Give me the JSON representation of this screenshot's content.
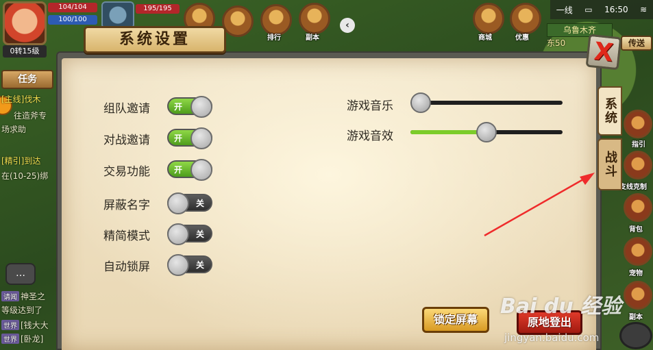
{
  "hud": {
    "level_text": "0转15级",
    "hp": "104/104",
    "mp": "100/100",
    "pet_hp": "195/195",
    "task_button": "任务",
    "top_icons": [
      "排行",
      "副本"
    ],
    "right_top_icons": [
      "商城",
      "优惠"
    ],
    "status_bar": {
      "line": "一线",
      "time": "16:50"
    },
    "map_name": "乌鲁木齐",
    "map_sub": "东50",
    "teleport": "传送",
    "right_side_icons": [
      "指引",
      "支线克制",
      "背包",
      "宠物",
      "副本"
    ]
  },
  "chat": {
    "lines": [
      {
        "text": "[主线]伐木",
        "color": "#f2e050"
      },
      {
        "text": "往造斧专",
        "color": "#e8e8c8"
      },
      {
        "text": "场求助",
        "color": "#e8e8c8"
      },
      {
        "text": "[精引]到达",
        "color": "#f2e050"
      },
      {
        "text": "在(10-25)绑",
        "color": "#e8e8c8"
      }
    ],
    "messages": [
      {
        "tag": "请闻",
        "text": "神圣之"
      },
      {
        "tag": "",
        "text": "等级达到了"
      },
      {
        "tag": "世界",
        "text": "[钱大大"
      },
      {
        "tag": "世界",
        "text": "[卧龙]"
      }
    ]
  },
  "dialog": {
    "title": "系统设置",
    "close_label": "X",
    "tabs": [
      {
        "label": "系统",
        "active": true
      },
      {
        "label": "战斗",
        "active": false
      }
    ],
    "settings": [
      {
        "label": "组队邀请",
        "on": true
      },
      {
        "label": "对战邀请",
        "on": true
      },
      {
        "label": "交易功能",
        "on": true
      },
      {
        "label": "屏蔽名字",
        "on": false
      },
      {
        "label": "精简模式",
        "on": false
      },
      {
        "label": "自动锁屏",
        "on": false
      }
    ],
    "toggle_on_text": "开",
    "toggle_off_text": "关",
    "audio": [
      {
        "label": "游戏音乐",
        "level": 0.0
      },
      {
        "label": "游戏音效",
        "level": 0.5
      }
    ],
    "lock_screen_button": "锁定屏幕",
    "logout_button": "原地登出"
  },
  "watermark": {
    "brand": "Bai du 经验",
    "url": "jingyan.baidu.com"
  },
  "colors": {
    "annotation_arrow": "#ef2b2b",
    "toggle_on": "#6cc02c",
    "slider_fill": "#7ccc2a"
  }
}
